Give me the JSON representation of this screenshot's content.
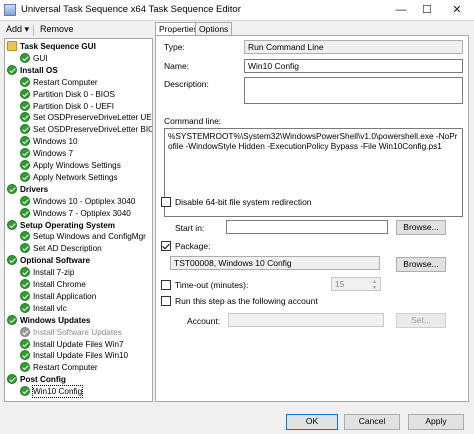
{
  "window": {
    "title": "Universal Task Sequence x64 Task Sequence Editor"
  },
  "toolbar": {
    "add_label": "Add ▾",
    "remove_label": "Remove"
  },
  "tree": {
    "items": [
      {
        "label": "Task Sequence GUI",
        "type": "group",
        "icon": "folder-icon"
      },
      {
        "label": "GUI",
        "type": "step",
        "icon": "success-check-icon"
      },
      {
        "label": "Install OS",
        "type": "group",
        "icon": "success-check-icon"
      },
      {
        "label": "Restart Computer",
        "type": "step",
        "icon": "success-check-icon"
      },
      {
        "label": "Partition Disk 0 - BIOS",
        "type": "step",
        "icon": "success-check-icon"
      },
      {
        "label": "Partition Disk 0 - UEFI",
        "type": "step",
        "icon": "success-check-icon"
      },
      {
        "label": "Set OSDPreserveDriveLetter UEFI",
        "type": "step",
        "icon": "success-check-icon"
      },
      {
        "label": "Set OSDPreserveDriveLetter BIOS",
        "type": "step",
        "icon": "success-check-icon"
      },
      {
        "label": "Windows 10",
        "type": "step",
        "icon": "success-check-icon"
      },
      {
        "label": "Windows 7",
        "type": "step",
        "icon": "success-check-icon"
      },
      {
        "label": "Apply Windows Settings",
        "type": "step",
        "icon": "success-check-icon"
      },
      {
        "label": "Apply Network Settings",
        "type": "step",
        "icon": "success-check-icon"
      },
      {
        "label": "Drivers",
        "type": "group",
        "icon": "success-check-icon"
      },
      {
        "label": "Windows 10 - Optiplex 3040",
        "type": "step",
        "icon": "success-check-icon"
      },
      {
        "label": "Windows 7 - Optiplex 3040",
        "type": "step",
        "icon": "success-check-icon"
      },
      {
        "label": "Setup Operating System",
        "type": "group",
        "icon": "success-check-icon"
      },
      {
        "label": "Setup Windows and ConfigMgr",
        "type": "step",
        "icon": "success-check-icon"
      },
      {
        "label": "Set AD Description",
        "type": "step",
        "icon": "success-check-icon"
      },
      {
        "label": "Optional Software",
        "type": "group",
        "icon": "success-check-icon"
      },
      {
        "label": "Install 7-zip",
        "type": "step",
        "icon": "success-check-icon"
      },
      {
        "label": "Install Chrome",
        "type": "step",
        "icon": "success-check-icon"
      },
      {
        "label": "Install Application",
        "type": "step",
        "icon": "success-check-icon"
      },
      {
        "label": "Install vlc",
        "type": "step",
        "icon": "success-check-icon"
      },
      {
        "label": "Windows Updates",
        "type": "group",
        "icon": "success-check-icon"
      },
      {
        "label": "Install Software Updates",
        "type": "step",
        "icon": "disabled-step-icon",
        "disabled": true
      },
      {
        "label": "Install Update Files Win7",
        "type": "step",
        "icon": "success-check-icon"
      },
      {
        "label": "Install Update Files Win10",
        "type": "step",
        "icon": "success-check-icon"
      },
      {
        "label": "Restart Computer",
        "type": "step",
        "icon": "success-check-icon"
      },
      {
        "label": "Post Config",
        "type": "group",
        "icon": "success-check-icon"
      },
      {
        "label": "Win10 Config",
        "type": "step",
        "icon": "success-check-icon",
        "selected": true
      }
    ]
  },
  "tabs": [
    {
      "label": "Properties",
      "active": true
    },
    {
      "label": "Options",
      "active": false
    }
  ],
  "properties": {
    "type_label": "Type:",
    "type_value": "Run Command Line",
    "name_label": "Name:",
    "name_value": "Win10 Config",
    "description_label": "Description:",
    "description_value": "",
    "command_line_label": "Command line:",
    "command_line_value": "%SYSTEMROOT%\\System32\\WindowsPowerShell\\v1.0\\powershell.exe -NoProfile -WindowStyle Hidden -ExecutionPolicy Bypass -File Win10Config.ps1",
    "disable_64bit_label": "Disable 64-bit file system redirection",
    "disable_64bit_checked": false,
    "start_in_label": "Start in:",
    "start_in_value": "",
    "browse_label": "Browse...",
    "package_label": "Package:",
    "package_checked": true,
    "package_value": "TST00008, Windows 10 Config",
    "timeout_label": "Time-out (minutes):",
    "timeout_checked": false,
    "timeout_value": "15",
    "run_as_label": "Run this step as the following account",
    "run_as_checked": false,
    "account_label": "Account:",
    "account_value": "",
    "set_label": "Set..."
  },
  "footer": {
    "ok_label": "OK",
    "cancel_label": "Cancel",
    "apply_label": "Apply"
  }
}
